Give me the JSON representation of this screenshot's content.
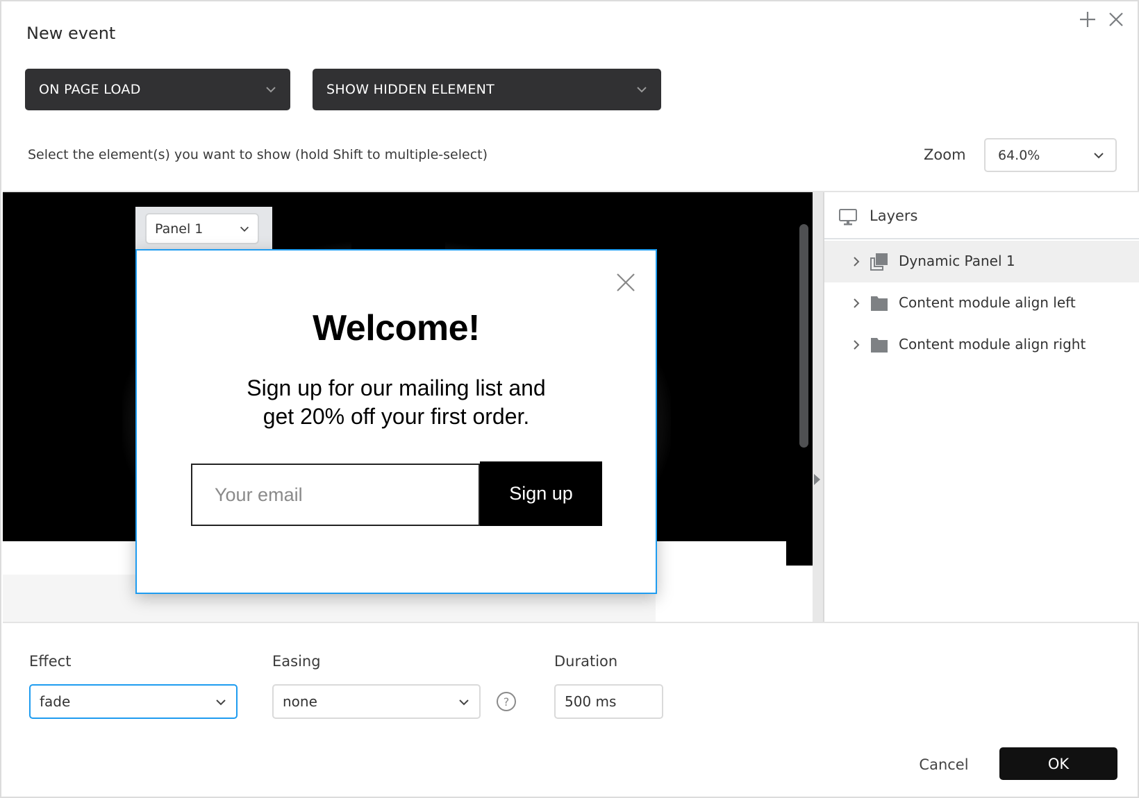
{
  "dialog": {
    "title": "New event",
    "window_buttons": {
      "add": "plus-icon",
      "close": "close-icon"
    }
  },
  "trigger_select": {
    "value": "ON PAGE LOAD"
  },
  "action_select": {
    "value": "SHOW HIDDEN ELEMENT"
  },
  "instruction": "Select the element(s) you want to show (hold Shift to multiple-select)",
  "zoom": {
    "label": "Zoom",
    "value": "64.0%"
  },
  "canvas": {
    "panel_state_select": {
      "value": "Panel 1"
    },
    "popup": {
      "heading": "Welcome!",
      "body_line1": "Sign up for our mailing list and",
      "body_line2": "get 20% off your first order.",
      "email_placeholder": "Your email",
      "signup_label": "Sign up",
      "accent_color": "#1e9cf0"
    }
  },
  "layers": {
    "title": "Layers",
    "items": [
      {
        "label": "Dynamic Panel 1",
        "icon": "dynamic-panel-icon",
        "selected": true
      },
      {
        "label": "Content module align left",
        "icon": "folder-icon",
        "selected": false
      },
      {
        "label": "Content module align right",
        "icon": "folder-icon",
        "selected": false
      }
    ]
  },
  "options": {
    "effect": {
      "label": "Effect",
      "value": "fade"
    },
    "easing": {
      "label": "Easing",
      "value": "none"
    },
    "duration": {
      "label": "Duration",
      "value": "500 ms"
    }
  },
  "footer": {
    "cancel_label": "Cancel",
    "ok_label": "OK"
  }
}
